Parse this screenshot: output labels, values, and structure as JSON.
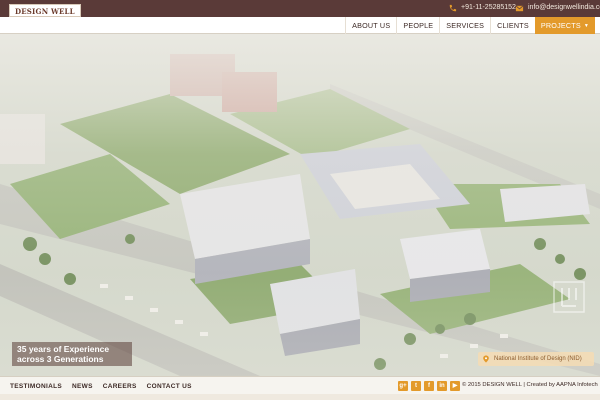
{
  "brand": {
    "logo_text": "DESIGN WELL"
  },
  "contact": {
    "phone": "+91-11-25285152",
    "email": "info@designwellindia.com"
  },
  "nav": {
    "items": [
      "ABOUT US",
      "PEOPLE",
      "SERVICES",
      "CLIENTS"
    ],
    "active": "PROJECTS",
    "active_caret": "▼"
  },
  "hero": {
    "tagline_line1": "35 years of Experience",
    "tagline_line2": "across 3 Generations",
    "caption": "National Institute of Design (NID)"
  },
  "footer": {
    "links": [
      "TESTIMONIALS",
      "NEWS",
      "CAREERS",
      "CONTACT US"
    ],
    "socials": [
      "g+",
      "t",
      "f",
      "in",
      "▶"
    ],
    "copyright": "© 2015 DESIGN WELL | Created by AAPNA Infotech"
  },
  "colors": {
    "topbar": "#5a3a38",
    "accent": "#e39a2b",
    "footer": "#f6f4ef"
  }
}
